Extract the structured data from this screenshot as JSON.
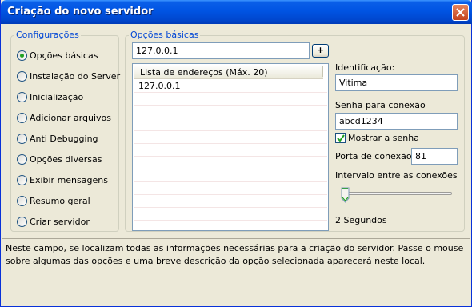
{
  "window": {
    "title": "Criação do novo servidor"
  },
  "configuracoes": {
    "legend": "Configurações",
    "items": [
      {
        "label": "Opções básicas",
        "checked": true
      },
      {
        "label": "Instalação do Server",
        "checked": false
      },
      {
        "label": "Inicialização",
        "checked": false
      },
      {
        "label": "Adicionar arquivos",
        "checked": false
      },
      {
        "label": "Anti Debugging",
        "checked": false
      },
      {
        "label": "Opções diversas",
        "checked": false
      },
      {
        "label": "Exibir mensagens",
        "checked": false
      },
      {
        "label": "Resumo geral",
        "checked": false
      },
      {
        "label": "Criar servidor",
        "checked": false
      }
    ]
  },
  "opcoes_basicas": {
    "legend": "Opções básicas",
    "address_input": "127.0.0.1",
    "add_button": "+",
    "list": {
      "header": "Lista de endereços (Máx. 20)",
      "rows": [
        "127.0.0.1"
      ]
    },
    "identificacao": {
      "label": "Identificação:",
      "value": "Vitima"
    },
    "senha": {
      "label": "Senha para conexão",
      "value": "abcd1234"
    },
    "mostrar_senha": {
      "label": "Mostrar a senha",
      "checked": true
    },
    "porta": {
      "label": "Porta de conexão",
      "value": "81"
    },
    "intervalo": {
      "label": "Intervalo entre as conexões",
      "slider_fraction": 0.0,
      "readout": "2 Segundos"
    }
  },
  "description": "Neste campo, se localizam todas as informações necessárias para a criação do servidor. Passe o mouse sobre algumas das opções e uma breve descrição da opção selecionada aparecerá neste local.",
  "colors": {
    "title_bar": "#0054e3",
    "legend_text": "#0046d5",
    "close_button": "#c4421c",
    "checkmark": "#21a121"
  }
}
